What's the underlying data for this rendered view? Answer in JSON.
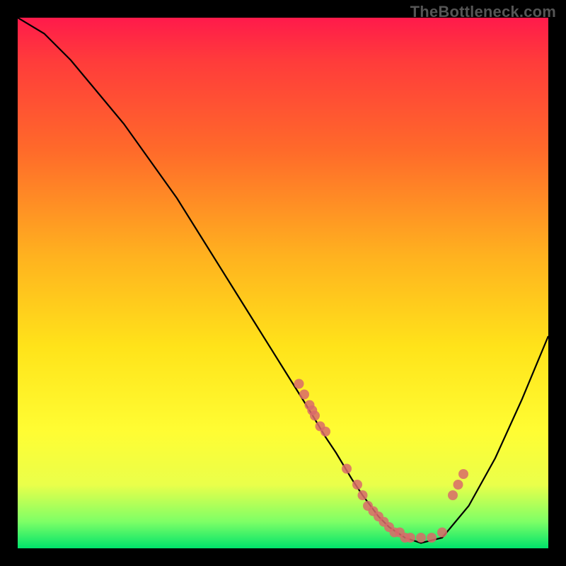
{
  "watermark": "TheBottleneck.com",
  "chart_data": {
    "type": "line",
    "title": "",
    "xlabel": "",
    "ylabel": "",
    "xlim": [
      0,
      100
    ],
    "ylim": [
      0,
      100
    ],
    "series": [
      {
        "name": "curve",
        "x": [
          0,
          5,
          10,
          15,
          20,
          25,
          30,
          35,
          40,
          45,
          50,
          55,
          58,
          60,
          63,
          65,
          68,
          70,
          73,
          76,
          80,
          85,
          90,
          95,
          100
        ],
        "values": [
          100,
          97,
          92,
          86,
          80,
          73,
          66,
          58,
          50,
          42,
          34,
          26,
          21,
          18,
          13,
          10,
          6,
          4,
          2,
          1,
          2,
          8,
          17,
          28,
          40
        ]
      }
    ],
    "scatter": {
      "name": "points",
      "color": "#d96a6a",
      "x": [
        53,
        54,
        55,
        55.5,
        56,
        57,
        58,
        62,
        64,
        65,
        66,
        67,
        68,
        69,
        70,
        71,
        72,
        73,
        74,
        76,
        78,
        80,
        82,
        83,
        84
      ],
      "values": [
        31,
        29,
        27,
        26,
        25,
        23,
        22,
        15,
        12,
        10,
        8,
        7,
        6,
        5,
        4,
        3,
        3,
        2,
        2,
        2,
        2,
        3,
        10,
        12,
        14
      ]
    }
  }
}
